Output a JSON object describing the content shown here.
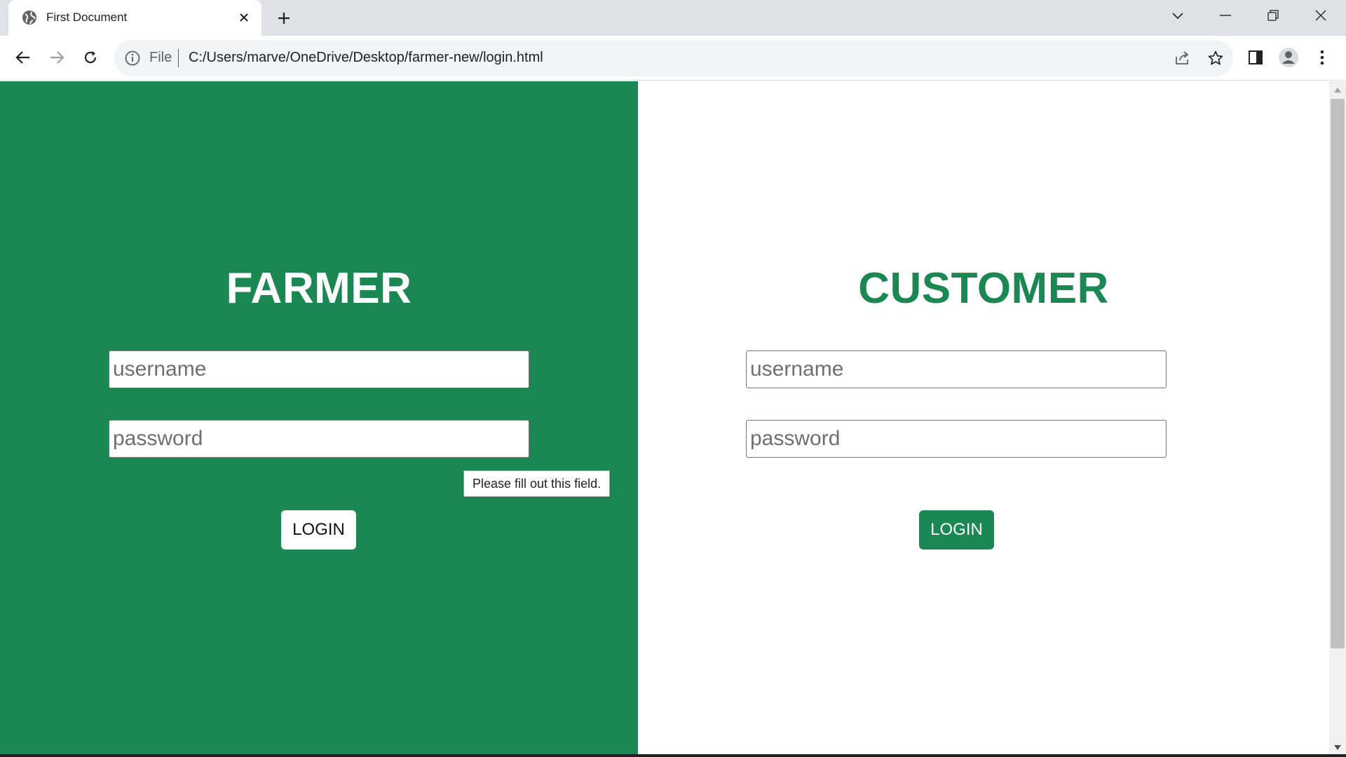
{
  "tab": {
    "title": "First Document"
  },
  "address_bar": {
    "scheme_label": "File",
    "url": "C:/Users/marve/OneDrive/Desktop/farmer-new/login.html"
  },
  "farmer": {
    "heading": "FARMER",
    "username_placeholder": "username",
    "password_placeholder": "password",
    "login_label": "LOGIN"
  },
  "customer": {
    "heading": "CUSTOMER",
    "username_placeholder": "username",
    "password_placeholder": "password",
    "login_label": "LOGIN"
  },
  "validation_tooltip": "Please fill out this field.",
  "colors": {
    "brand_green": "#1b8753",
    "tabstrip": "#dee1e6",
    "omnibox": "#f1f3f4"
  },
  "icons": [
    "globe-icon",
    "close-icon",
    "plus-icon",
    "chevron-down-icon",
    "minimize-icon",
    "restore-icon",
    "window-close-icon",
    "back-icon",
    "forward-icon",
    "reload-icon",
    "info-icon",
    "share-icon",
    "star-icon",
    "side-panel-icon",
    "profile-icon",
    "menu-icon"
  ]
}
